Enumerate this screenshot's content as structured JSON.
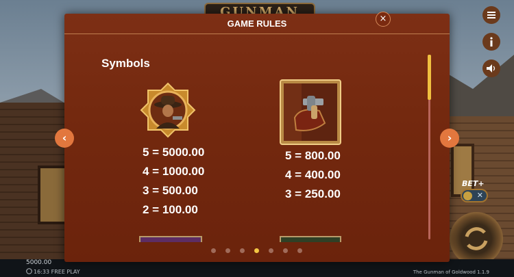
{
  "game": {
    "logo_text": "GUNMAN",
    "balance": "5000.00",
    "clock_mode": "16:33 FREE PLAY",
    "version": "The Gunman of Goldwood  1.1.9",
    "bet_plus_label": "BET+"
  },
  "modal": {
    "title": "GAME RULES",
    "close_glyph": "×",
    "section_title": "Symbols",
    "prev_glyph": "‹",
    "next_glyph": "›",
    "page_count": 7,
    "active_page": 4,
    "symbols": [
      {
        "icon": "gunslinger-icon",
        "payouts": [
          "5 = 5000.00",
          "4 = 1000.00",
          "3 = 500.00",
          "2 = 100.00"
        ]
      },
      {
        "icon": "revolver-holster-icon",
        "payouts": [
          "5 = 800.00",
          "4 = 400.00",
          "3 = 250.00"
        ]
      }
    ]
  },
  "colors": {
    "modal_bg": "#74290f",
    "accent_orange": "#e2773e",
    "active_dot": "#f2c744"
  }
}
